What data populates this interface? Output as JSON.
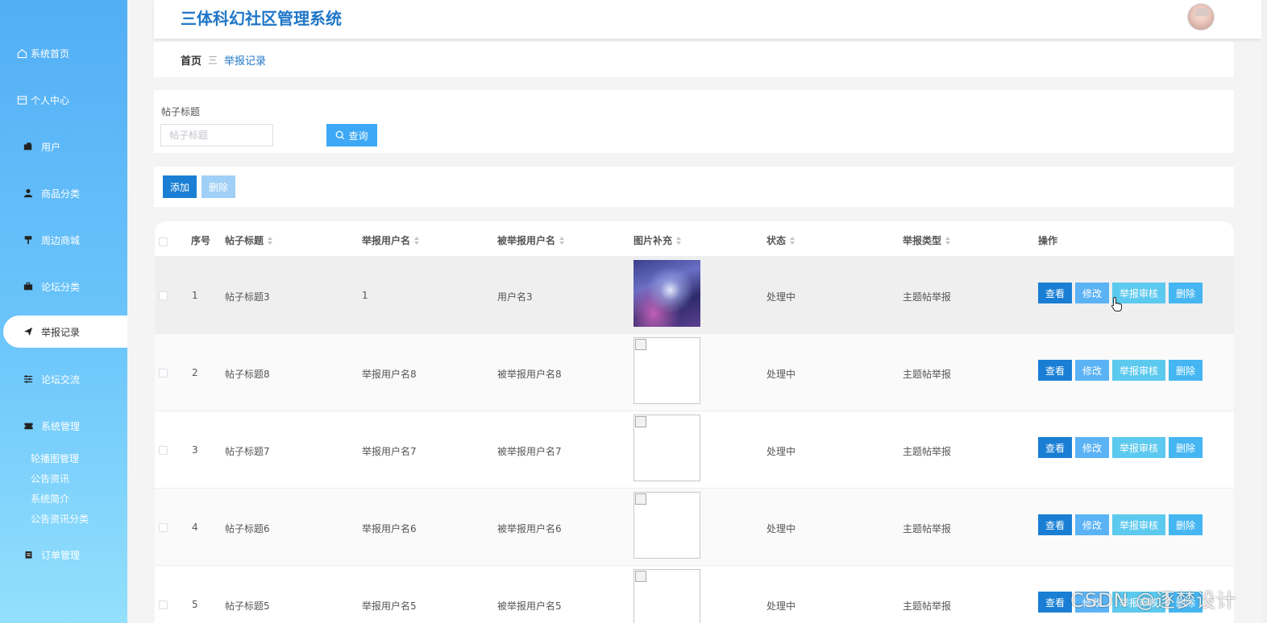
{
  "app": {
    "title": "三体科幻社区管理系统"
  },
  "colors": {
    "brand": "#1f76c7",
    "sidebar_top": "#52aef5",
    "sidebar_bottom": "#93e0fc",
    "primary_button": "#1a7fd4"
  },
  "sidebar": {
    "items": [
      {
        "label": "系统首页",
        "icon": "home-icon"
      },
      {
        "label": "个人中心",
        "icon": "calendar-icon"
      },
      {
        "label": "用户",
        "icon": "wallet-icon"
      },
      {
        "label": "商品分类",
        "icon": "user-icon"
      },
      {
        "label": "周边商城",
        "icon": "signpost-icon"
      },
      {
        "label": "论坛分类",
        "icon": "briefcase-icon"
      },
      {
        "label": "举报记录",
        "icon": "send-icon",
        "active": true
      },
      {
        "label": "论坛交流",
        "icon": "sliders-icon"
      },
      {
        "label": "系统管理",
        "icon": "ticket-icon"
      },
      {
        "label": "订单管理",
        "icon": "clipboard-icon"
      }
    ],
    "subitems": [
      "轮播图管理",
      "公告资讯",
      "系统简介",
      "公告资讯分类"
    ]
  },
  "breadcrumb": {
    "home": "首页",
    "separator": "三",
    "current": "举报记录"
  },
  "search": {
    "label": "帖子标题",
    "placeholder": "帖子标题",
    "button": "查询"
  },
  "actions": {
    "add": "添加",
    "delete": "删除"
  },
  "table": {
    "columns": [
      "序号",
      "帖子标题",
      "举报用户名",
      "被举报用户名",
      "图片补充",
      "状态",
      "举报类型",
      "操作"
    ],
    "rows": [
      {
        "index": "1",
        "post_title": "帖子标题3",
        "reporter": "1",
        "reported": "用户名3",
        "status": "处理中",
        "type": "主题帖举报",
        "has_image": true
      },
      {
        "index": "2",
        "post_title": "帖子标题8",
        "reporter": "举报用户名8",
        "reported": "被举报用户名8",
        "status": "处理中",
        "type": "主题帖举报",
        "has_image": false
      },
      {
        "index": "3",
        "post_title": "帖子标题7",
        "reporter": "举报用户名7",
        "reported": "被举报用户名7",
        "status": "处理中",
        "type": "主题帖举报",
        "has_image": false
      },
      {
        "index": "4",
        "post_title": "帖子标题6",
        "reporter": "举报用户名6",
        "reported": "被举报用户名6",
        "status": "处理中",
        "type": "主题帖举报",
        "has_image": false
      },
      {
        "index": "5",
        "post_title": "帖子标题5",
        "reporter": "举报用户名5",
        "reported": "被举报用户名5",
        "status": "处理中",
        "type": "主题帖举报",
        "has_image": false
      }
    ],
    "row_actions": {
      "view": "查看",
      "edit": "修改",
      "audit": "举报审核",
      "delete": "删除"
    }
  },
  "watermark": "CSDN @逐梦设计"
}
